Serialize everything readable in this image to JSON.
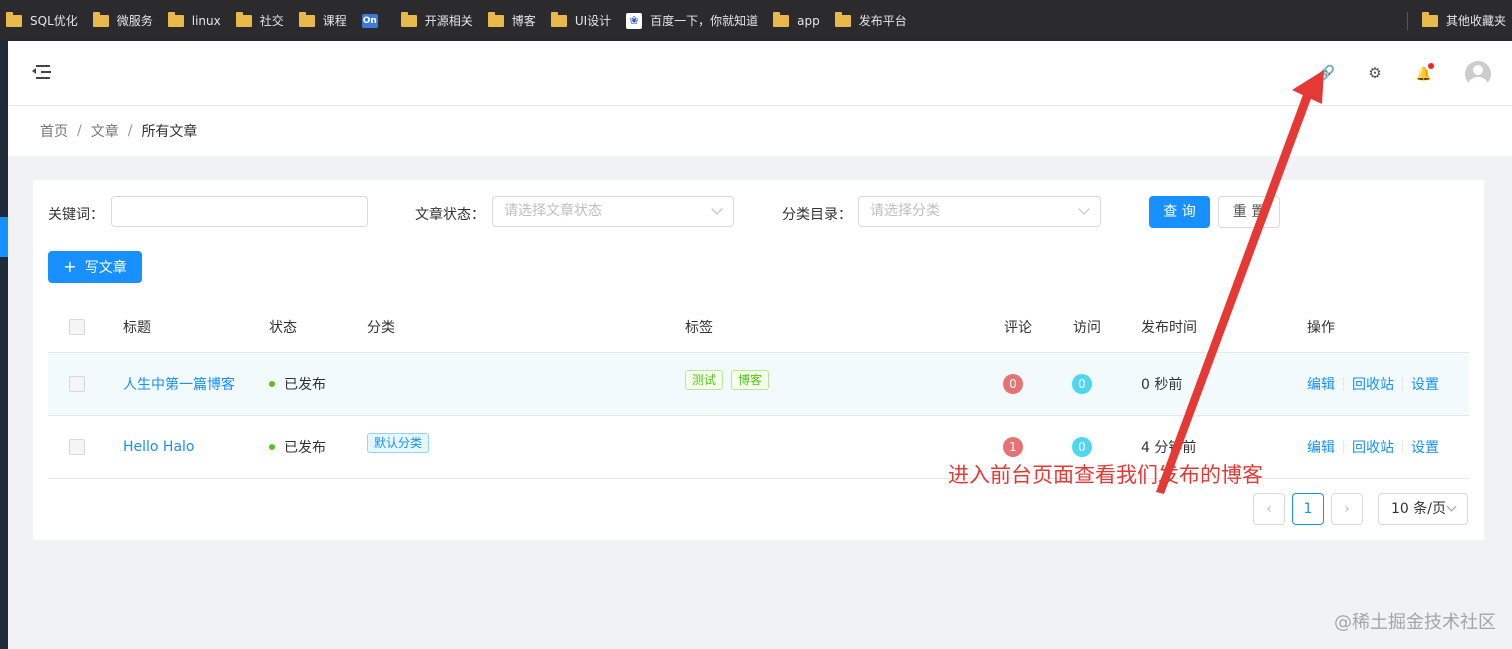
{
  "bookmarks": [
    {
      "label": "SQL优化",
      "icon": "folder-icon"
    },
    {
      "label": "微服务",
      "icon": "folder-icon"
    },
    {
      "label": "linux",
      "icon": "folder-icon"
    },
    {
      "label": "社交",
      "icon": "folder-icon"
    },
    {
      "label": "课程",
      "icon": "folder-icon"
    },
    {
      "label": "On",
      "icon": "on-app-icon"
    },
    {
      "label": "开源相关",
      "icon": "folder-icon"
    },
    {
      "label": "博客",
      "icon": "folder-icon"
    },
    {
      "label": "UI设计",
      "icon": "folder-icon"
    },
    {
      "label": "百度一下，你就知道",
      "icon": "baidu-icon"
    },
    {
      "label": "app",
      "icon": "folder-icon"
    },
    {
      "label": "发布平台",
      "icon": "folder-icon"
    }
  ],
  "bookmarks_other": "其他收藏夹",
  "header": {
    "icons": [
      "menu-fold-icon",
      "link-icon",
      "gear-icon",
      "bell-icon",
      "avatar"
    ],
    "link_glyph": "🔗",
    "gear_glyph": "⚙",
    "bell_glyph": "🔔"
  },
  "breadcrumb": {
    "home": "首页",
    "posts": "文章",
    "current": "所有文章",
    "separator": "/"
  },
  "filters": {
    "keyword_label": "关键词：",
    "keyword_value": "",
    "status_label": "文章状态：",
    "status_placeholder": "请选择文章状态",
    "category_label": "分类目录：",
    "category_placeholder": "请选择分类",
    "query_button": "查 询",
    "reset_button": "重 置"
  },
  "write_button": {
    "plus": "+",
    "label": "写文章"
  },
  "table": {
    "columns": [
      "标题",
      "状态",
      "分类",
      "标签",
      "评论",
      "访问",
      "发布时间",
      "操作"
    ],
    "rows": [
      {
        "title": "人生中第一篇博客",
        "status": "已发布",
        "categories": [],
        "tags": [
          "测试",
          "博客"
        ],
        "comments": "0",
        "visits": "0",
        "published": "0 秒前",
        "actions": [
          "编辑",
          "回收站",
          "设置"
        ]
      },
      {
        "title": "Hello Halo",
        "status": "已发布",
        "categories": [
          "默认分类"
        ],
        "tags": [],
        "comments": "1",
        "visits": "0",
        "published": "4 分钟前",
        "actions": [
          "编辑",
          "回收站",
          "设置"
        ]
      }
    ]
  },
  "pagination": {
    "prev": "‹",
    "current": "1",
    "next": "›",
    "page_size": "10 条/页"
  },
  "annotation": {
    "text": "进入前台页面查看我们发布的博客",
    "color": "#e53935"
  },
  "watermark": "@稀土掘金技术社区",
  "colors": {
    "primary": "#1890ff",
    "success": "#52c41a",
    "header_bg": "#2b2b2d"
  }
}
